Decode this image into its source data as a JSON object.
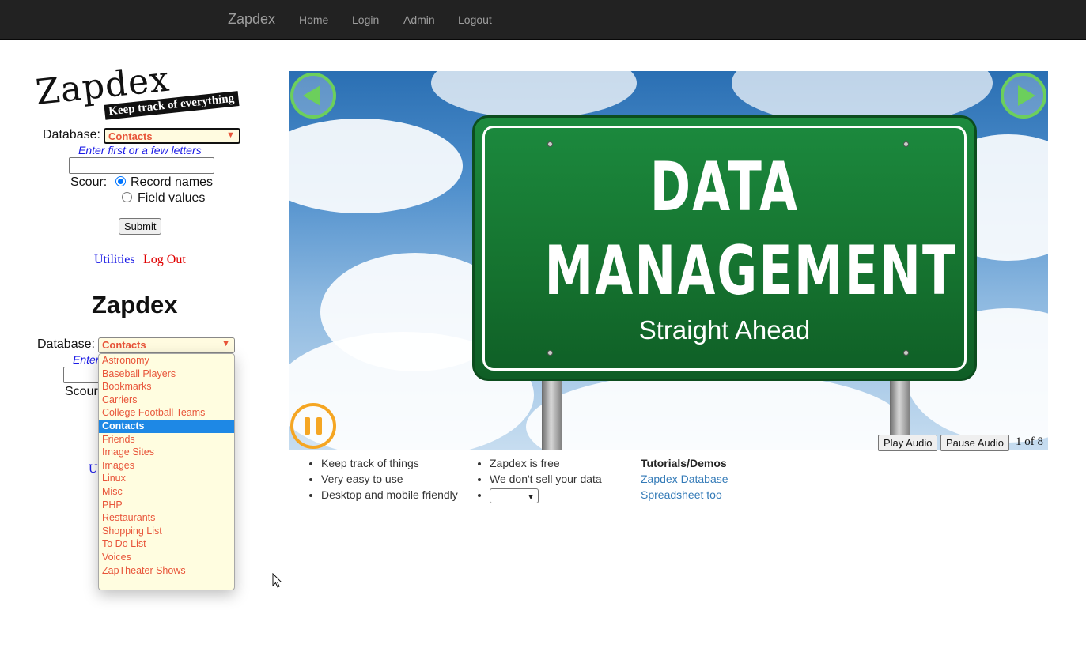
{
  "navbar": {
    "brand": "Zapdex",
    "links": [
      "Home",
      "Login",
      "Admin",
      "Logout"
    ]
  },
  "logo": {
    "word": "Zapdex",
    "tagline": "Keep track of everything"
  },
  "form1": {
    "database_label": "Database:",
    "database_value": "Contacts",
    "hint": "Enter first or a few letters",
    "search_value": "",
    "scour_label": "Scour:",
    "radio_record": "Record names",
    "radio_field": "Field values",
    "submit": "Submit",
    "utilities": "Utilities",
    "logout": "Log Out"
  },
  "form2": {
    "heading": "Zapdex",
    "database_label": "Database:",
    "database_value": "Contacts",
    "hint_partial": "Enter",
    "scour_partial": "Scour",
    "utilities_partial": "U"
  },
  "dropdown": {
    "selected": "Contacts",
    "options": [
      "Astronomy",
      "Baseball Players",
      "Bookmarks",
      "Carriers",
      "College Football Teams",
      "Contacts",
      "Friends",
      "Image Sites",
      "Images",
      "Linux",
      "Misc",
      "PHP",
      "Restaurants",
      "Shopping List",
      "To Do List",
      "Voices",
      "ZapTheater Shows"
    ]
  },
  "slide": {
    "title_line1": "DATA",
    "title_line2": "MANAGEMENT",
    "subtitle": "Straight Ahead",
    "play_audio": "Play Audio",
    "pause_audio": "Pause Audio",
    "counter": "1 of 8"
  },
  "features": {
    "col1": [
      "Keep track of things",
      "Very easy to use",
      "Desktop and mobile friendly"
    ],
    "col2": [
      "Zapdex is free",
      "We don't sell your data"
    ]
  },
  "tutorials": {
    "heading": "Tutorials/Demos",
    "links": [
      "Zapdex Database",
      "Spreadsheet too"
    ]
  },
  "colors": {
    "navbar_bg": "#222222",
    "nav_text": "#9d9d9d",
    "select_text": "#e8553a",
    "select_bg": "#fffbe0",
    "hint_blue": "#1a1ae6",
    "logout_red": "#e00000",
    "selected_option": "#1e88e5",
    "link_blue": "#337ab7",
    "sign_green": "#15722f"
  }
}
